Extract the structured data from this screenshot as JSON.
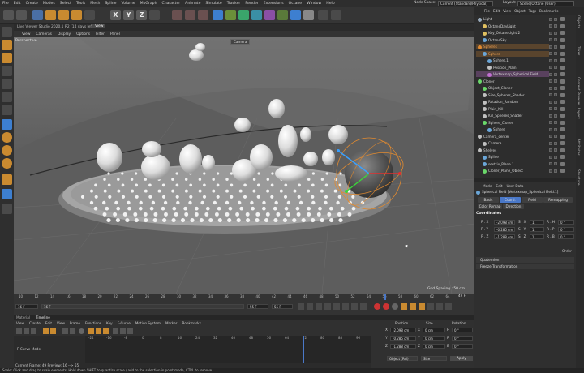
{
  "menubar": {
    "items": [
      "File",
      "Edit",
      "Create",
      "Modes",
      "Select",
      "Tools",
      "Mesh",
      "Spline",
      "Volume",
      "MoGraph",
      "Character",
      "Animate",
      "Simulate",
      "Tracker",
      "Render",
      "Extensions",
      "Octane",
      "Window",
      "Help"
    ],
    "node_space_label": "Node Space:",
    "node_space_value": "Current (Standard/Physical)",
    "layout_label": "Layout:",
    "layout_value": "Scene(Octane (User)"
  },
  "toolbar": {
    "axis": [
      "X",
      "Y",
      "Z"
    ]
  },
  "viewport": {
    "title": "Live Viewer Studio 2020.1 R2 (14 days left)",
    "title_right": "View",
    "menu": [
      "View",
      "Cameras",
      "Display",
      "Options",
      "Filter",
      "Panel"
    ],
    "label": "Perspective",
    "camera_tag": "Camera",
    "grid_spacing": "Grid Spacing : 50 cm"
  },
  "timeline": {
    "ticks": [
      "10",
      "12",
      "14",
      "16",
      "18",
      "20",
      "22",
      "24",
      "26",
      "28",
      "30",
      "32",
      "34",
      "36",
      "38",
      "40",
      "42",
      "44",
      "46",
      "48",
      "50",
      "52",
      "54",
      "56",
      "58",
      "60",
      "62",
      "64"
    ],
    "current_frame_right": "49 F",
    "start": "16 F",
    "start2": "16 F",
    "end": "55 F",
    "end2": "55 F"
  },
  "bottom": {
    "tabs": [
      "Material",
      "Timeline"
    ],
    "menu": [
      "View",
      "Create",
      "Edit",
      "View",
      "Frame",
      "Functions",
      "Key",
      "F-Curve",
      "Motion System",
      "Marker",
      "Bookmarks"
    ],
    "fcurve_mode": "F-Curve Mode",
    "current_frame": "Current Frame: 49  Preview: 16 --> 55",
    "ticks": [
      "-24",
      "-16",
      "-8",
      "0",
      "8",
      "16",
      "24",
      "32",
      "40",
      "48",
      "56",
      "64",
      "72",
      "80",
      "88",
      "96"
    ],
    "coords": {
      "headers": [
        "Position",
        "Size",
        "Rotation"
      ],
      "rows": [
        {
          "axis": "X",
          "pos": "-2.098 cm",
          "size": "0 cm",
          "rotlabel": "H",
          "rot": "0 °"
        },
        {
          "axis": "Y",
          "pos": "-0.285 cm",
          "size": "0 cm",
          "rotlabel": "P",
          "rot": "0 °"
        },
        {
          "axis": "Z",
          "pos": "-1.288 cm",
          "size": "0 cm",
          "rotlabel": "B",
          "rot": "0 °"
        }
      ],
      "mode_select": "Object (Rel)",
      "size_select": "Size",
      "apply": "Apply"
    }
  },
  "objects": {
    "menu": [
      "File",
      "Edit",
      "View",
      "Object",
      "Tags",
      "Bookmarks"
    ],
    "rows": [
      {
        "name": "Light",
        "indent": 0,
        "color": "#9ab"
      },
      {
        "name": "OctaneDayLight",
        "indent": 1,
        "color": "#e0c060"
      },
      {
        "name": "Key_OctaneLight.2",
        "indent": 1,
        "color": "#e0c060"
      },
      {
        "name": "OctaneSky",
        "indent": 1,
        "color": "#6aa6d8"
      },
      {
        "name": "Spheres",
        "indent": 0,
        "color": "#e08a30",
        "highlight": "orange"
      },
      {
        "name": "Sphere",
        "indent": 1,
        "color": "#6aa6d8",
        "highlight": "orange"
      },
      {
        "name": "Sphere.1",
        "indent": 2,
        "color": "#6aa6d8"
      },
      {
        "name": "Position_Plain",
        "indent": 2,
        "color": "#c0c0c0"
      },
      {
        "name": "Vertexmap_Spherical Field",
        "indent": 2,
        "color": "#c070d0",
        "highlight": "purple"
      },
      {
        "name": "Cloner",
        "indent": 0,
        "color": "#6ad86a"
      },
      {
        "name": "Object_Cloner",
        "indent": 1,
        "color": "#6ad86a"
      },
      {
        "name": "Size_Spheres_Shader",
        "indent": 1,
        "color": "#c0c0c0"
      },
      {
        "name": "Rotation_Random",
        "indent": 1,
        "color": "#c0c0c0"
      },
      {
        "name": "Plain_Kill",
        "indent": 1,
        "color": "#c0c0c0"
      },
      {
        "name": "Kill_Spheres_Shader",
        "indent": 1,
        "color": "#c0c0c0"
      },
      {
        "name": "Sphere_Cloner",
        "indent": 1,
        "color": "#6ad86a"
      },
      {
        "name": "Sphere",
        "indent": 2,
        "color": "#6aa6d8"
      },
      {
        "name": "Camera_center",
        "indent": 0,
        "color": "#c0c0c0"
      },
      {
        "name": "Camera",
        "indent": 1,
        "color": "#c0c0c0"
      },
      {
        "name": "Shelves",
        "indent": 0,
        "color": "#c0c0c0"
      },
      {
        "name": "Spline",
        "indent": 1,
        "color": "#6aa6d8"
      },
      {
        "name": "sextrix_Plane.1",
        "indent": 1,
        "color": "#6aa6d8"
      },
      {
        "name": "Cloner_Plane_Object",
        "indent": 1,
        "color": "#6ad86a"
      }
    ]
  },
  "attributes": {
    "menu": [
      "Mode",
      "Edit",
      "User Data"
    ],
    "object_title": "Spherical Field [Vertexmap_Spherical Field.1]",
    "tabs": [
      "Basic",
      "Coord.",
      "Field",
      "Remapping"
    ],
    "tabs2": [
      "Color Remap",
      "Direction"
    ],
    "section_coordinates": "Coordinates",
    "rows": [
      {
        "p": "P . X",
        "pv": "-2.098 cm",
        "s": "S . X",
        "sv": "1",
        "r": "R . H",
        "rv": "0 °"
      },
      {
        "p": "P . Y",
        "pv": "-0.285 cm",
        "s": "S . Y",
        "sv": "1",
        "r": "R . P",
        "rv": "0 °"
      },
      {
        "p": "P . Z",
        "pv": "-1.288 cm",
        "s": "S . Z",
        "sv": "1",
        "r": "R . B",
        "rv": "0 °"
      }
    ],
    "order_label": "Order",
    "section_quaternion": "Quaternion",
    "section_freeze": "Freeze Transformation"
  },
  "side_tabs": [
    "Objects",
    "Takes",
    "Content Browser",
    "Layers",
    "Attributes",
    "Structure"
  ],
  "status": "Scale: Click and drag to scale elements. Hold down SHIFT to quantize scale / add to the selection in point mode, CTRL to remove."
}
